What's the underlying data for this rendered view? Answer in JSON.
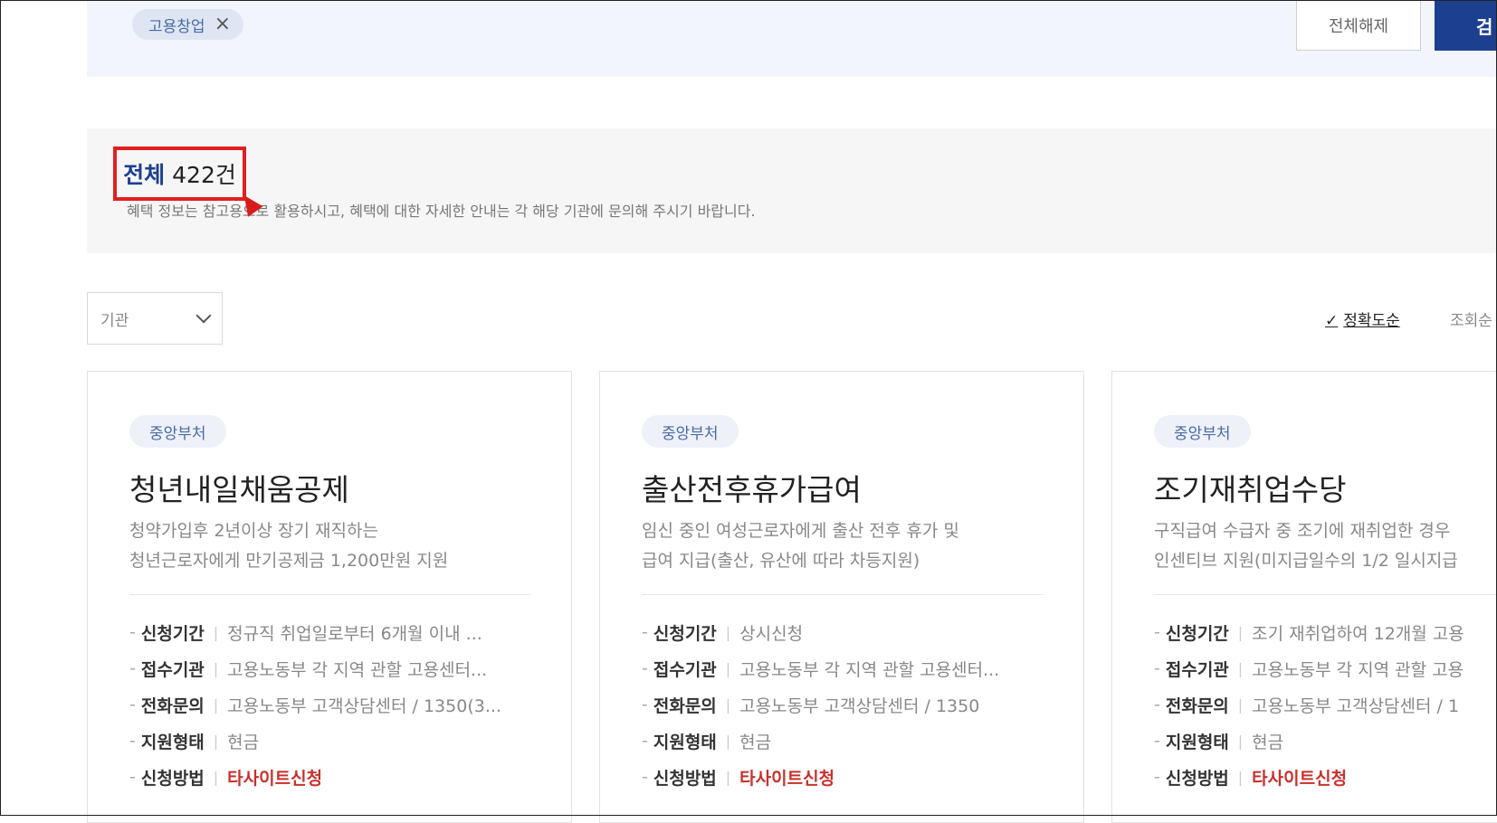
{
  "filters": {
    "chip_label": "고용창업",
    "clear_label": "전체해제",
    "search_label": "검"
  },
  "summary": {
    "total_label": "전체",
    "total_count": "422건",
    "notice": "혜택 정보는 참고용으로 활용하시고, 혜택에 대한 자세한 안내는 각 해당 기관에 문의해 주시기 바랍니다."
  },
  "controls": {
    "agency_dropdown": "기관",
    "sort_accuracy": "정확도순",
    "sort_views": "조회순"
  },
  "cards": [
    {
      "badge": "중앙부처",
      "title": "청년내일채움공제",
      "desc": [
        "청약가입후 2년이상 장기 재직하는",
        "청년근로자에게 만기공제금 1,200만원 지원"
      ],
      "rows": [
        {
          "k": "신청기간",
          "v": "정규직 취업일로부터 6개월 이내 ..."
        },
        {
          "k": "접수기관",
          "v": "고용노동부 각 지역 관할 고용센터..."
        },
        {
          "k": "전화문의",
          "v": "고용노동부 고객상담센터 / 1350(3..."
        },
        {
          "k": "지원형태",
          "v": "현금"
        },
        {
          "k": "신청방법",
          "v": "타사이트신청"
        }
      ]
    },
    {
      "badge": "중앙부처",
      "title": "출산전후휴가급여",
      "desc": [
        "임신 중인 여성근로자에게 출산 전후 휴가 및",
        "급여 지급(출산, 유산에 따라 차등지원)"
      ],
      "rows": [
        {
          "k": "신청기간",
          "v": "상시신청"
        },
        {
          "k": "접수기관",
          "v": "고용노동부 각 지역 관할 고용센터..."
        },
        {
          "k": "전화문의",
          "v": "고용노동부 고객상담센터 / 1350"
        },
        {
          "k": "지원형태",
          "v": "현금"
        },
        {
          "k": "신청방법",
          "v": "타사이트신청"
        }
      ]
    },
    {
      "badge": "중앙부처",
      "title": "조기재취업수당",
      "desc": [
        "구직급여 수급자 중 조기에 재취업한 경우",
        "인센티브 지원(미지급일수의 1/2 일시지급"
      ],
      "rows": [
        {
          "k": "신청기간",
          "v": "조기 재취업하여 12개월 고용"
        },
        {
          "k": "접수기관",
          "v": "고용노동부 각 지역 관할 고용"
        },
        {
          "k": "전화문의",
          "v": "고용노동부 고객상담센터 / 1"
        },
        {
          "k": "지원형태",
          "v": "현금"
        },
        {
          "k": "신청방법",
          "v": "타사이트신청"
        }
      ]
    }
  ]
}
